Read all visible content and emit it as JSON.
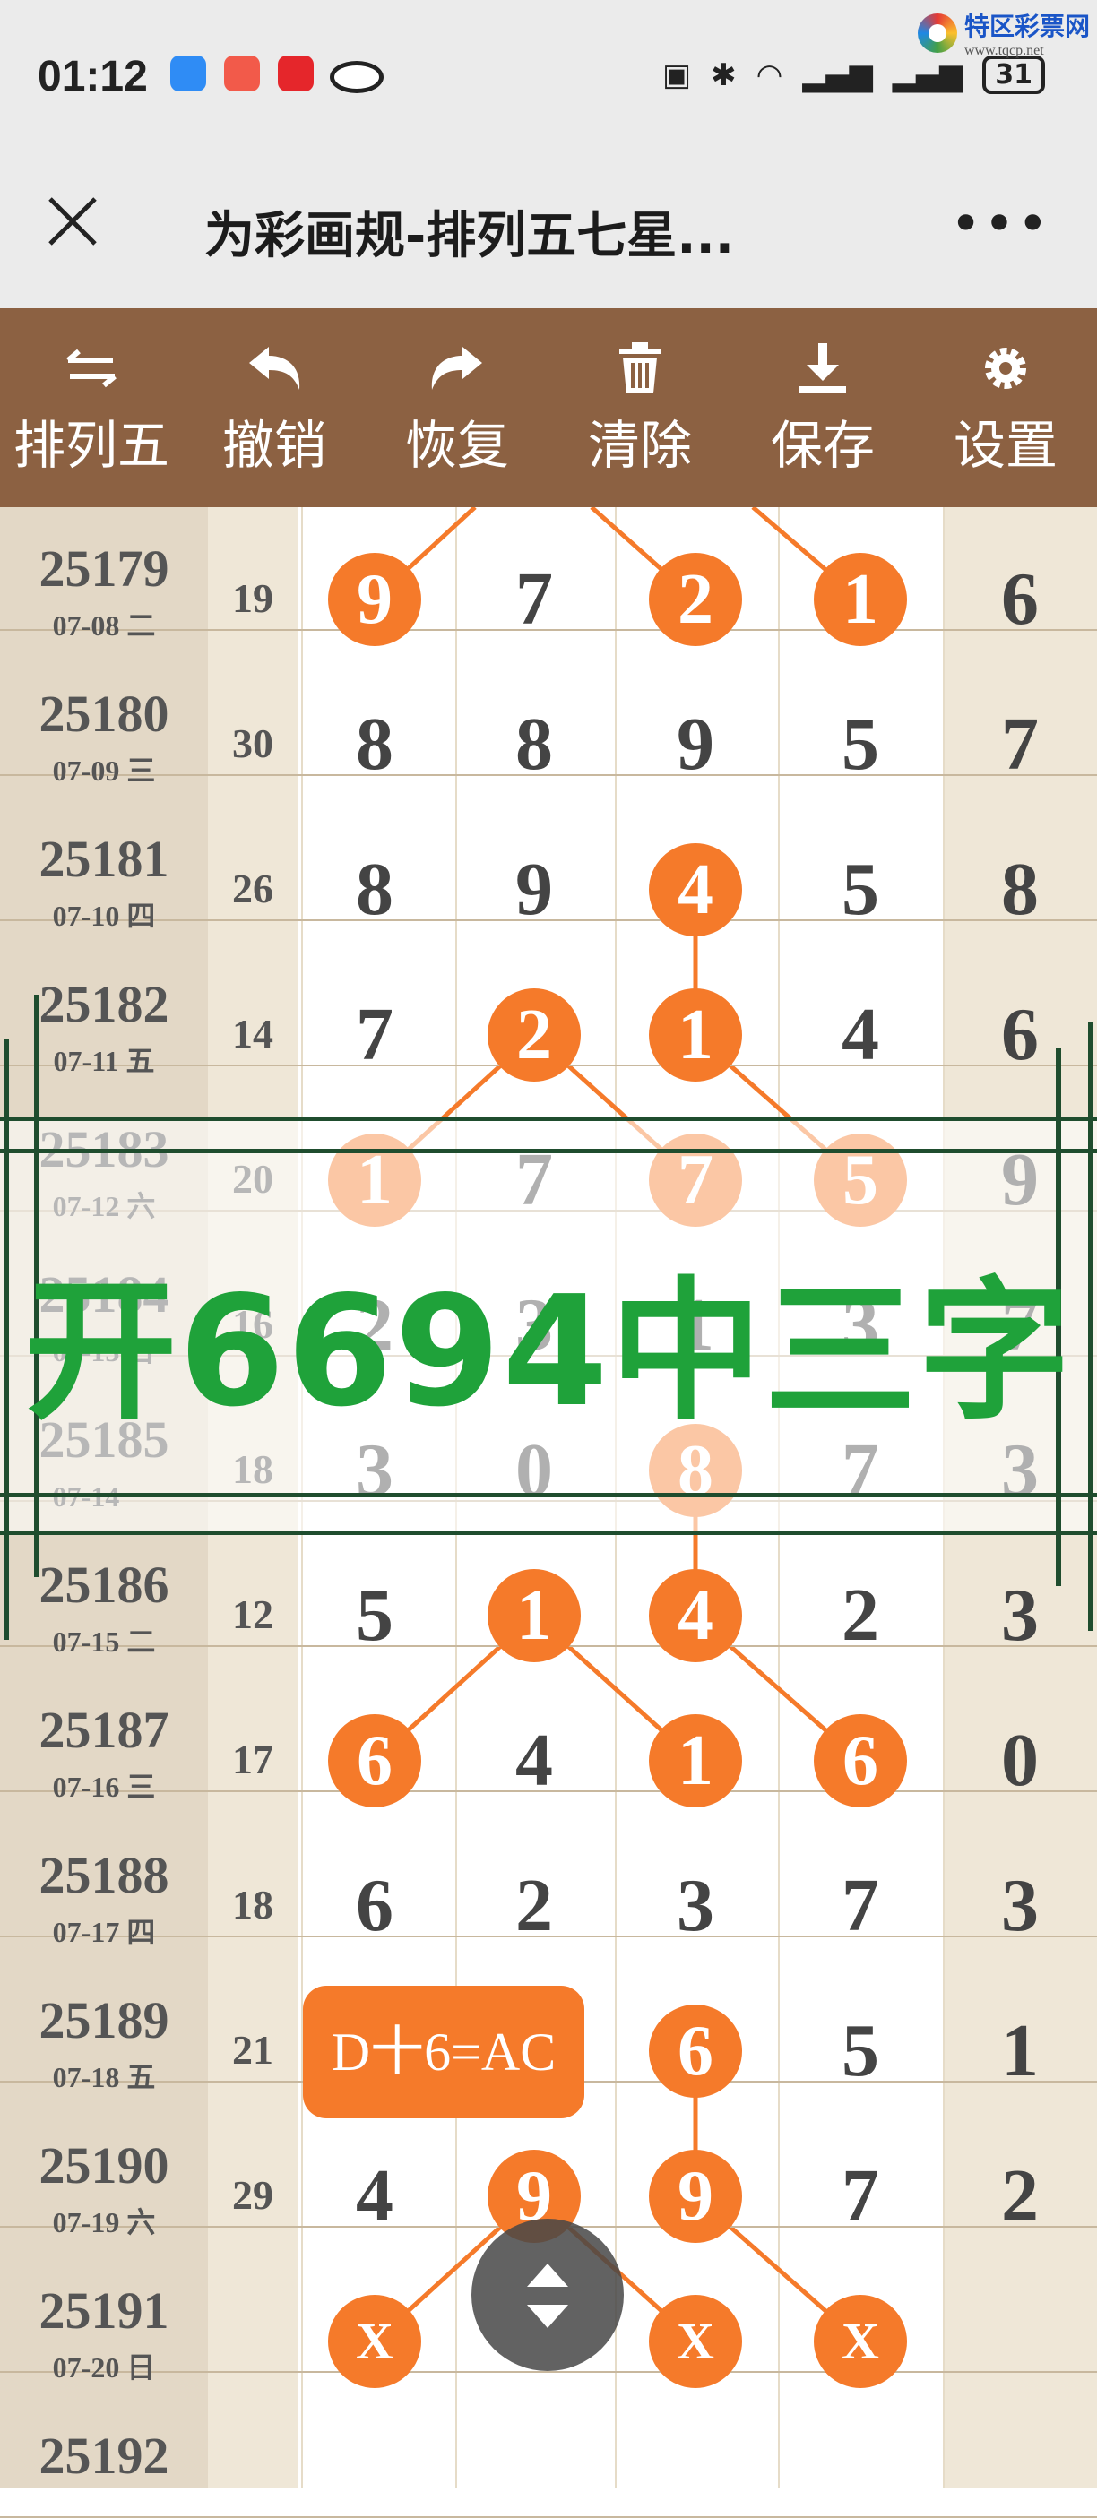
{
  "status_bar": {
    "time": "01:12",
    "battery": "31",
    "network_icons": [
      "nfc-icon",
      "bluetooth-icon",
      "wifi-icon",
      "signal-icon",
      "signal-icon"
    ]
  },
  "watermark": {
    "title": "特区彩票网",
    "url": "www.tqcp.net"
  },
  "title_bar": {
    "title": "为彩画规-排列五七星..."
  },
  "toolbar": {
    "items": [
      {
        "label": "排列五",
        "icon": "swap-icon"
      },
      {
        "label": "撤销",
        "icon": "undo-icon"
      },
      {
        "label": "恢复",
        "icon": "redo-icon"
      },
      {
        "label": "清除",
        "icon": "trash-icon"
      },
      {
        "label": "保存",
        "icon": "download-icon"
      },
      {
        "label": "设置",
        "icon": "gear-icon"
      }
    ]
  },
  "rows": [
    {
      "issue": "25179",
      "date": "07-08 二",
      "sum": "19",
      "digits": [
        "9",
        "7",
        "2",
        "1",
        "6"
      ],
      "balls": [
        0,
        2,
        3
      ]
    },
    {
      "issue": "25180",
      "date": "07-09 三",
      "sum": "30",
      "digits": [
        "8",
        "8",
        "9",
        "5",
        "7"
      ],
      "balls": []
    },
    {
      "issue": "25181",
      "date": "07-10 四",
      "sum": "26",
      "digits": [
        "8",
        "9",
        "4",
        "5",
        "8"
      ],
      "balls": [
        2
      ]
    },
    {
      "issue": "25182",
      "date": "07-11 五",
      "sum": "14",
      "digits": [
        "7",
        "2",
        "1",
        "4",
        "6"
      ],
      "balls": [
        1,
        2
      ]
    },
    {
      "issue": "25183",
      "date": "07-12 六",
      "sum": "20",
      "digits": [
        "1",
        "7",
        "7",
        "5",
        "9"
      ],
      "balls": [
        0,
        2,
        3
      ]
    },
    {
      "issue": "25184",
      "date": "07-13 日",
      "sum": "16",
      "digits": [
        "2",
        "3",
        "1",
        "3",
        "7"
      ],
      "balls": []
    },
    {
      "issue": "25185",
      "date": "07-14 一",
      "sum": "18",
      "digits": [
        "3",
        "0",
        "8",
        "7",
        "3"
      ],
      "balls": [
        2
      ]
    },
    {
      "issue": "25186",
      "date": "07-15 二",
      "sum": "12",
      "digits": [
        "5",
        "1",
        "4",
        "2",
        "3"
      ],
      "balls": [
        1,
        2
      ]
    },
    {
      "issue": "25187",
      "date": "07-16 三",
      "sum": "17",
      "digits": [
        "6",
        "4",
        "1",
        "6",
        "0"
      ],
      "balls": [
        0,
        2,
        3
      ]
    },
    {
      "issue": "25188",
      "date": "07-17 四",
      "sum": "18",
      "digits": [
        "6",
        "2",
        "3",
        "7",
        "3"
      ],
      "balls": []
    },
    {
      "issue": "25189",
      "date": "07-18 五",
      "sum": "21",
      "digits": [
        "",
        "",
        "6",
        "5",
        "1"
      ],
      "balls": [
        2
      ]
    },
    {
      "issue": "25190",
      "date": "07-19 六",
      "sum": "29",
      "digits": [
        "4",
        "9",
        "9",
        "7",
        "2"
      ],
      "balls": [
        1,
        2
      ]
    },
    {
      "issue": "25191",
      "date": "07-20 日",
      "sum": "",
      "digits": [
        "X",
        "",
        "X",
        "X",
        ""
      ],
      "balls": [
        0,
        2,
        3
      ]
    },
    {
      "issue": "25192",
      "date": "",
      "sum": "",
      "digits": [
        "",
        "",
        "",
        "",
        ""
      ],
      "balls": []
    }
  ],
  "overlay": {
    "text": "开6694中三字"
  },
  "badge": {
    "text": "D十6=AC"
  },
  "colors": {
    "toolbar": "#8c6142",
    "ball": "#f57a2a",
    "overlay_text": "#1fa23a",
    "frame": "#1f4d2e"
  }
}
